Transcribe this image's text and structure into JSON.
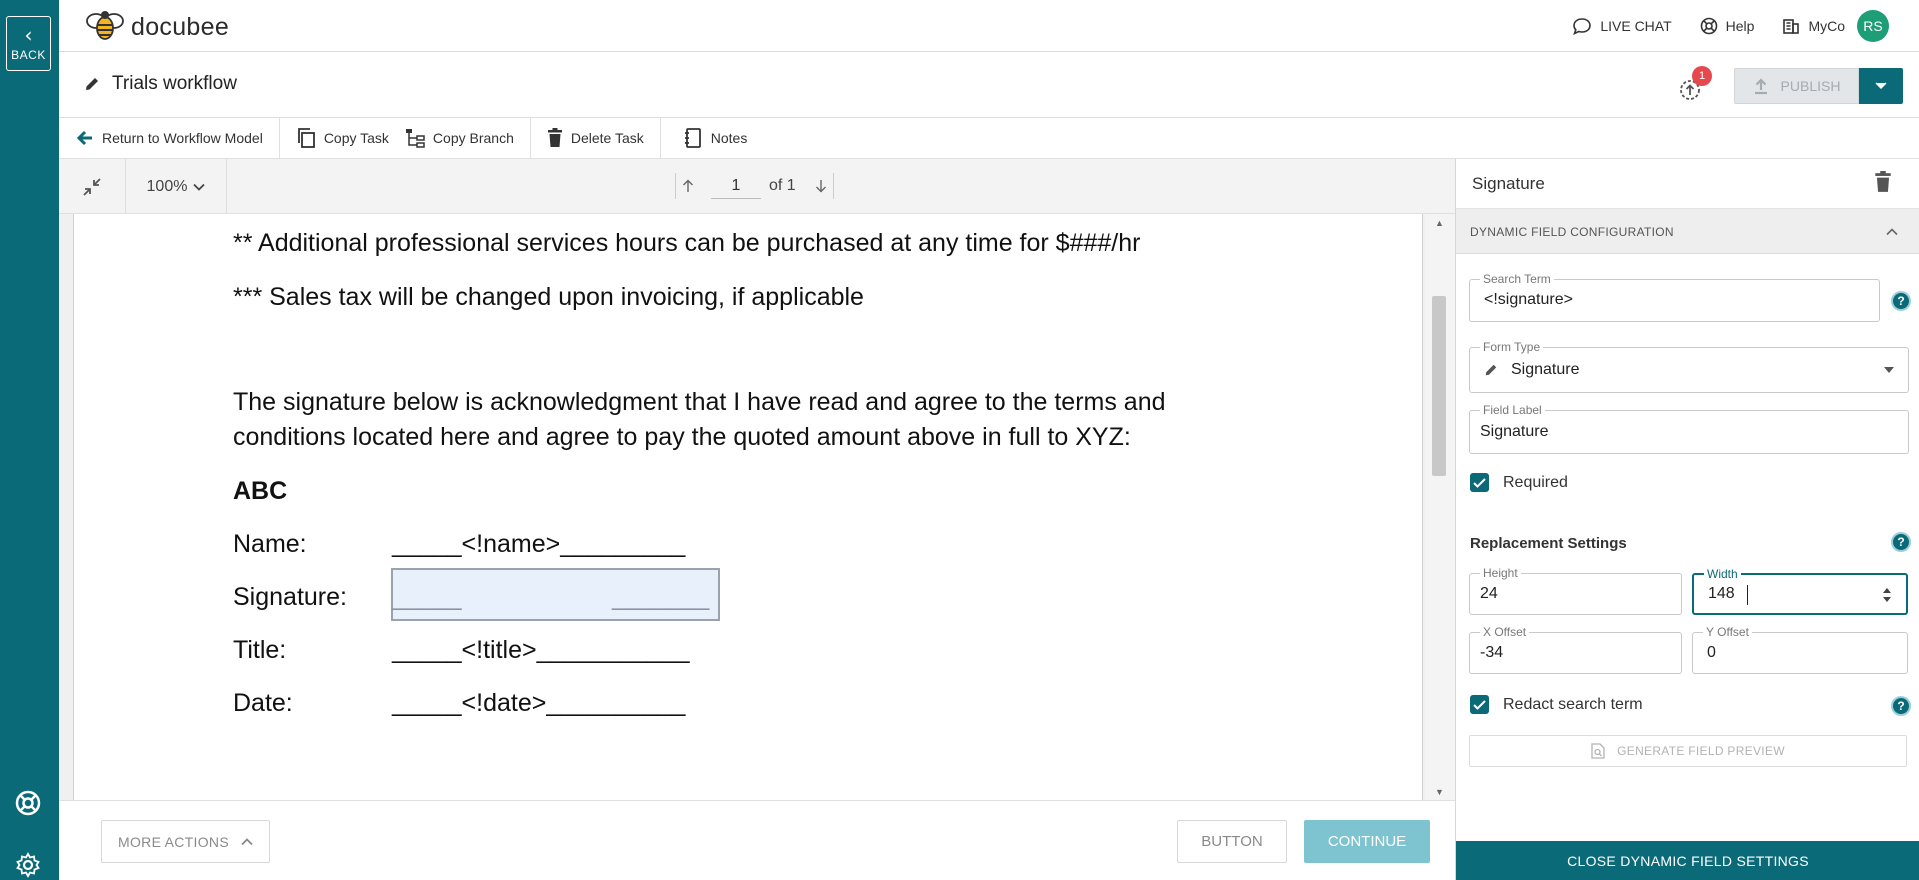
{
  "rail": {
    "back_label": "BACK"
  },
  "header": {
    "brand": "docubee",
    "live_chat": "LIVE CHAT",
    "help": "Help",
    "org": "MyCo",
    "avatar_initials": "RS"
  },
  "titlebar": {
    "workflow_title": "Trials workflow",
    "notification_count": "1",
    "publish_label": "PUBLISH"
  },
  "toolbar": {
    "return": "Return to Workflow Model",
    "copy_task": "Copy Task",
    "copy_branch": "Copy Branch",
    "delete_task": "Delete Task",
    "notes": "Notes"
  },
  "viewer": {
    "zoom": "100%",
    "page_current": "1",
    "page_of": "of 1"
  },
  "document": {
    "line1": "** Additional professional services hours can be purchased at any time for $###/hr",
    "line2": "*** Sales tax will be changed upon invoicing, if applicable",
    "para_line1": "The signature below is acknowledgment that I have read and agree to the terms and",
    "para_line2": "conditions located here and agree to pay the quoted amount above in full to XYZ:",
    "company": "ABC",
    "name_label": "Name:",
    "name_value": "_____<!name>_________",
    "signature_label": "Signature:",
    "signature_left": "_____",
    "signature_right": "_______",
    "title_label": "Title:",
    "title_value": "_____<!title>___________",
    "date_label": "Date:",
    "date_value": "_____<!date>__________"
  },
  "bottombar": {
    "more_actions": "MORE ACTIONS",
    "button": "BUTTON",
    "continue": "CONTINUE"
  },
  "panel": {
    "title": "Signature",
    "section_title": "DYNAMIC FIELD CONFIGURATION",
    "search_term_label": "Search Term",
    "search_term_value": "<!signature>",
    "form_type_label": "Form Type",
    "form_type_value": "Signature",
    "field_label_label": "Field Label",
    "field_label_value": "Signature",
    "required_label": "Required",
    "replacement_settings": "Replacement Settings",
    "height_label": "Height",
    "height_value": "24",
    "width_label": "Width",
    "width_value": "148",
    "x_offset_label": "X Offset",
    "x_offset_value": "-34",
    "y_offset_label": "Y Offset",
    "y_offset_value": "0",
    "redact_label": "Redact search term",
    "generate_preview": "GENERATE FIELD PREVIEW",
    "close_settings": "CLOSE DYNAMIC FIELD SETTINGS",
    "help_glyph": "?"
  },
  "colors": {
    "brand_teal": "#0b6a78",
    "continue_disabled": "#7ec3d0",
    "badge_red": "#e5484d",
    "avatar_green": "#1e9e77",
    "field_highlight": "#e8f1fb"
  },
  "icons": [
    "back-chevron-icon",
    "support-lifebuoy-icon",
    "settings-gear-icon",
    "bee-logo-icon",
    "chat-bubble-icon",
    "help-globe-icon",
    "building-icon",
    "pencil-icon",
    "sync-upload-icon",
    "upload-icon",
    "chevron-down-icon",
    "arrow-left-icon",
    "copy-icon",
    "branch-icon",
    "trash-icon",
    "notebook-icon",
    "collapse-icon",
    "arrow-up-icon",
    "arrow-down-icon",
    "chevron-up-icon",
    "checkbox-check-icon",
    "spinner-icon",
    "document-search-icon"
  ]
}
